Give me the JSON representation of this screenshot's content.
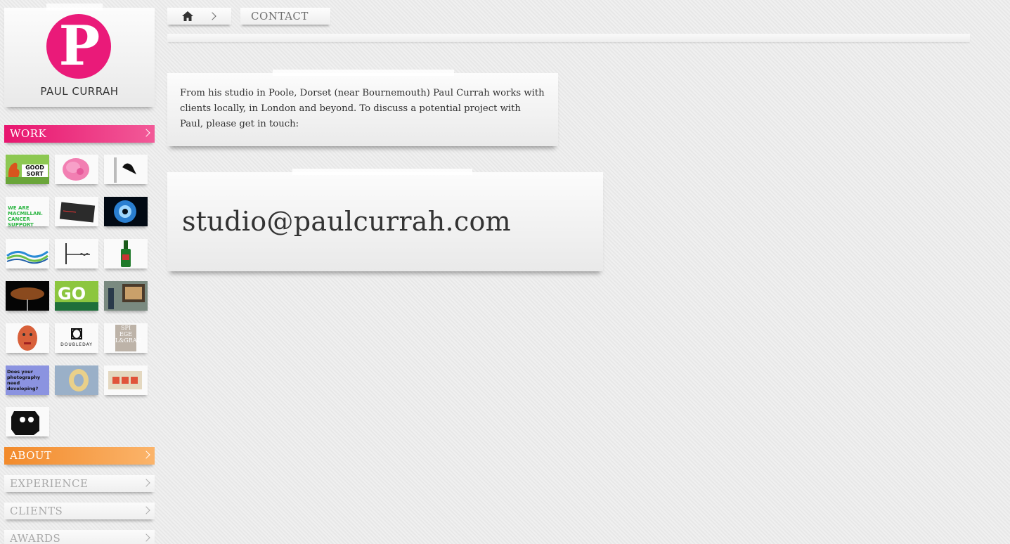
{
  "brand": {
    "logo_letter": "P",
    "name": "PAUL CURRAH",
    "accent": "#ea1a79"
  },
  "nav": {
    "work": "WORK",
    "about": "ABOUT",
    "experience": "EXPERIENCE",
    "clients": "CLIENTS",
    "awards": "AWARDS"
  },
  "thumbnails": {
    "t1_text": "GOOD SORT",
    "t4_text": "WE ARE MACMILLAN. CANCER SUPPORT",
    "t11_text": "GO",
    "t14_text": "DOUBLEDAY",
    "t15_text": "SPI EGE L&GRAU",
    "t16_text": "Does your photography need developing?"
  },
  "breadcrumb": {
    "current": "CONTACT"
  },
  "content": {
    "intro": "From his studio in Poole, Dorset (near Bournemouth) Paul Currah works with clients locally, in London and beyond. To discuss a potential project with Paul, please get in touch:",
    "email": "studio@paulcurrah.com"
  },
  "colors": {
    "work": "#e8156f",
    "about": "#f28a2b",
    "inactive_nav": "#a9a9a9"
  }
}
